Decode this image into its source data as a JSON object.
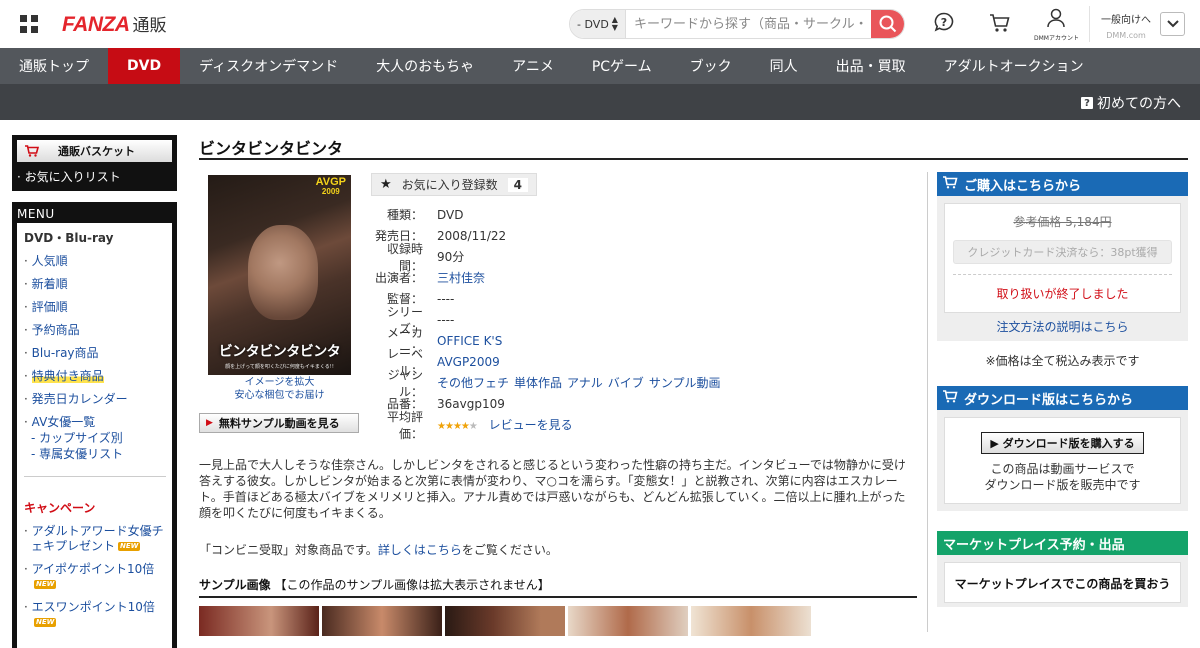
{
  "header": {
    "logo_main": "FANZA",
    "logo_sub": "通販",
    "search": {
      "category": "- DVD",
      "placeholder": "キーワードから探す（商品・サークル・作家）"
    },
    "account_label": "DMMアカウント",
    "audience_main": "一般向けへ",
    "audience_sub": "DMM.com"
  },
  "nav": {
    "items": [
      {
        "label": "通販トップ"
      },
      {
        "label": "DVD",
        "active": true
      },
      {
        "label": "ディスクオンデマンド"
      },
      {
        "label": "大人のおもちゃ"
      },
      {
        "label": "アニメ"
      },
      {
        "label": "PCゲーム"
      },
      {
        "label": "ブック"
      },
      {
        "label": "同人"
      },
      {
        "label": "出品・買取"
      },
      {
        "label": "アダルトオークション"
      }
    ],
    "first_time": "初めての方へ"
  },
  "sidebar": {
    "basket": "通販バスケット",
    "favorites": "お気に入りリスト",
    "menu_title": "MENU",
    "menu_head": "DVD・Blu-ray",
    "links": [
      "人気順",
      "新着順",
      "評価順",
      "予約商品",
      "Blu-ray商品",
      "特典付き商品",
      "発売日カレンダー",
      "AV女優一覧"
    ],
    "sublinks": [
      "カップサイズ別",
      "専属女優リスト"
    ],
    "campaign_head": "キャンペーン",
    "campaigns": [
      {
        "label": "アダルトアワード女優チェキプレゼント",
        "badge": "NEW"
      },
      {
        "label": "アイポケポイント10倍",
        "badge": "NEW"
      },
      {
        "label": "エスワンポイント10倍",
        "badge": "NEW"
      }
    ]
  },
  "product": {
    "title": "ビンタビンタビンタ",
    "cover": {
      "badge_main": "AVGP",
      "badge_sub": "2009",
      "title": "ビンタビンタビンタ",
      "caption": "顔を上げって顔を叩くたびに何度もイキまくる!!"
    },
    "cover_link_1": "イメージを拡大",
    "cover_link_2": "安心な梱包でお届け",
    "sample_button": "無料サンプル動画を見る",
    "fav_label": "お気に入り登録数",
    "fav_count": "4",
    "specs": [
      {
        "k": "種類：",
        "v": "DVD"
      },
      {
        "k": "発売日：",
        "v": "2008/11/22"
      },
      {
        "k": "収録時間：",
        "v": "90分"
      },
      {
        "k": "出演者：",
        "v": "三村佳奈",
        "link": true
      },
      {
        "k": "監督：",
        "v": "----"
      },
      {
        "k": "シリーズ：",
        "v": "----"
      },
      {
        "k": "メーカー：",
        "v": "OFFICE K'S",
        "link": true
      },
      {
        "k": "レーベル：",
        "v": "AVGP2009",
        "link": true
      }
    ],
    "genre_label": "ジャンル：",
    "genres": [
      "その他フェチ",
      "単体作品",
      "アナル",
      "バイブ",
      "サンプル動画"
    ],
    "code_label": "品番：",
    "code": "36avgp109",
    "rating_label": "平均評価：",
    "rating": 3.5,
    "review_link": "レビューを見る",
    "description": "一見上品で大人しそうな佳奈さん。しかしビンタをされると感じるという変わった性癖の持ち主だ。インタビューでは物静かに受け答えする彼女。しかしビンタが始まると次第に表情が変わり、マ○コを濡らす。「変態女！」と説教され、次第に内容はエスカレート。手首ほどある極太バイブをメリメリと挿入。アナル責めでは戸惑いながらも、どんどん拡張していく。二倍以上に腫れ上がった顔を叩くたびに何度もイキまくる。",
    "konbini_prefix": "「コンビニ受取」対象商品です。",
    "konbini_link": "詳しくはこちら",
    "konbini_suffix": "をご覧ください。",
    "sample_head_bold": "サンプル画像",
    "sample_head_note": "【この作品のサンプル画像は拡大表示されません】"
  },
  "purchase": {
    "head": "ご購入はこちらから",
    "ref_price": "参考価格 5,184円",
    "credit": "クレジットカード決済なら：38pt獲得",
    "ended": "取り扱いが終了しました",
    "order_link": "注文方法の説明はこちら",
    "tax_note": "※価格は全て税込み表示です"
  },
  "download": {
    "head": "ダウンロード版はこちらから",
    "button": "ダウンロード版を購入する",
    "text_1": "この商品は動画サービスで",
    "text_2": "ダウンロード版を販売中です"
  },
  "marketplace": {
    "head": "マーケットプレイス予約・出品",
    "text": "マーケットプレイスでこの商品を買おう"
  },
  "colors": {
    "brand_red": "#e4252c",
    "nav_bg": "#53575c",
    "active_red": "#c60c14",
    "link_blue": "#1c4f9e",
    "panel_blue": "#1a6ab5",
    "panel_green": "#14a36a"
  }
}
